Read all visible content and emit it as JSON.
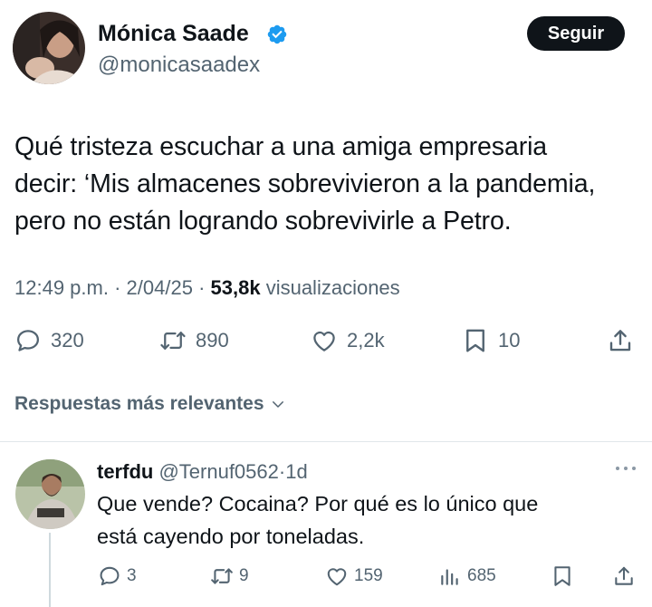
{
  "author": {
    "name": "Mónica Saade",
    "handle": "@monicasaadex",
    "verified": true,
    "follow_label": "Seguir"
  },
  "tweet": {
    "text": "Qué tristeza escuchar a una amiga empresaria\ndecir: ‘Mis almacenes sobrevivieron a la pandemia,\npero no están logrando sobrevivirle a Petro.",
    "time": "12:49 p.m.",
    "date": "2/04/25",
    "views_count": "53,8k",
    "views_label": "visualizaciones",
    "separator": "·"
  },
  "stats": {
    "replies": "320",
    "reposts": "890",
    "likes": "2,2k",
    "bookmarks": "10"
  },
  "sort_label": "Respuestas más relevantes",
  "reply": {
    "name": "terfdu",
    "handle": "@Ternuf0562",
    "separator": "·",
    "time": "1d",
    "text": "Que vende? Cocaina? Por qué es lo único que\nestá cayendo por toneladas.",
    "stats": {
      "replies": "3",
      "reposts": "9",
      "likes": "159",
      "views": "685"
    }
  },
  "colors": {
    "text": "#0f1419",
    "secondary": "#536471",
    "verified_blue": "#1d9bf0",
    "button_bg": "#0f1419"
  },
  "icons": [
    "reply-icon",
    "repost-icon",
    "like-icon",
    "bookmark-icon",
    "share-icon",
    "views-icon",
    "more-icon",
    "verified-icon",
    "chevron-down-icon"
  ]
}
